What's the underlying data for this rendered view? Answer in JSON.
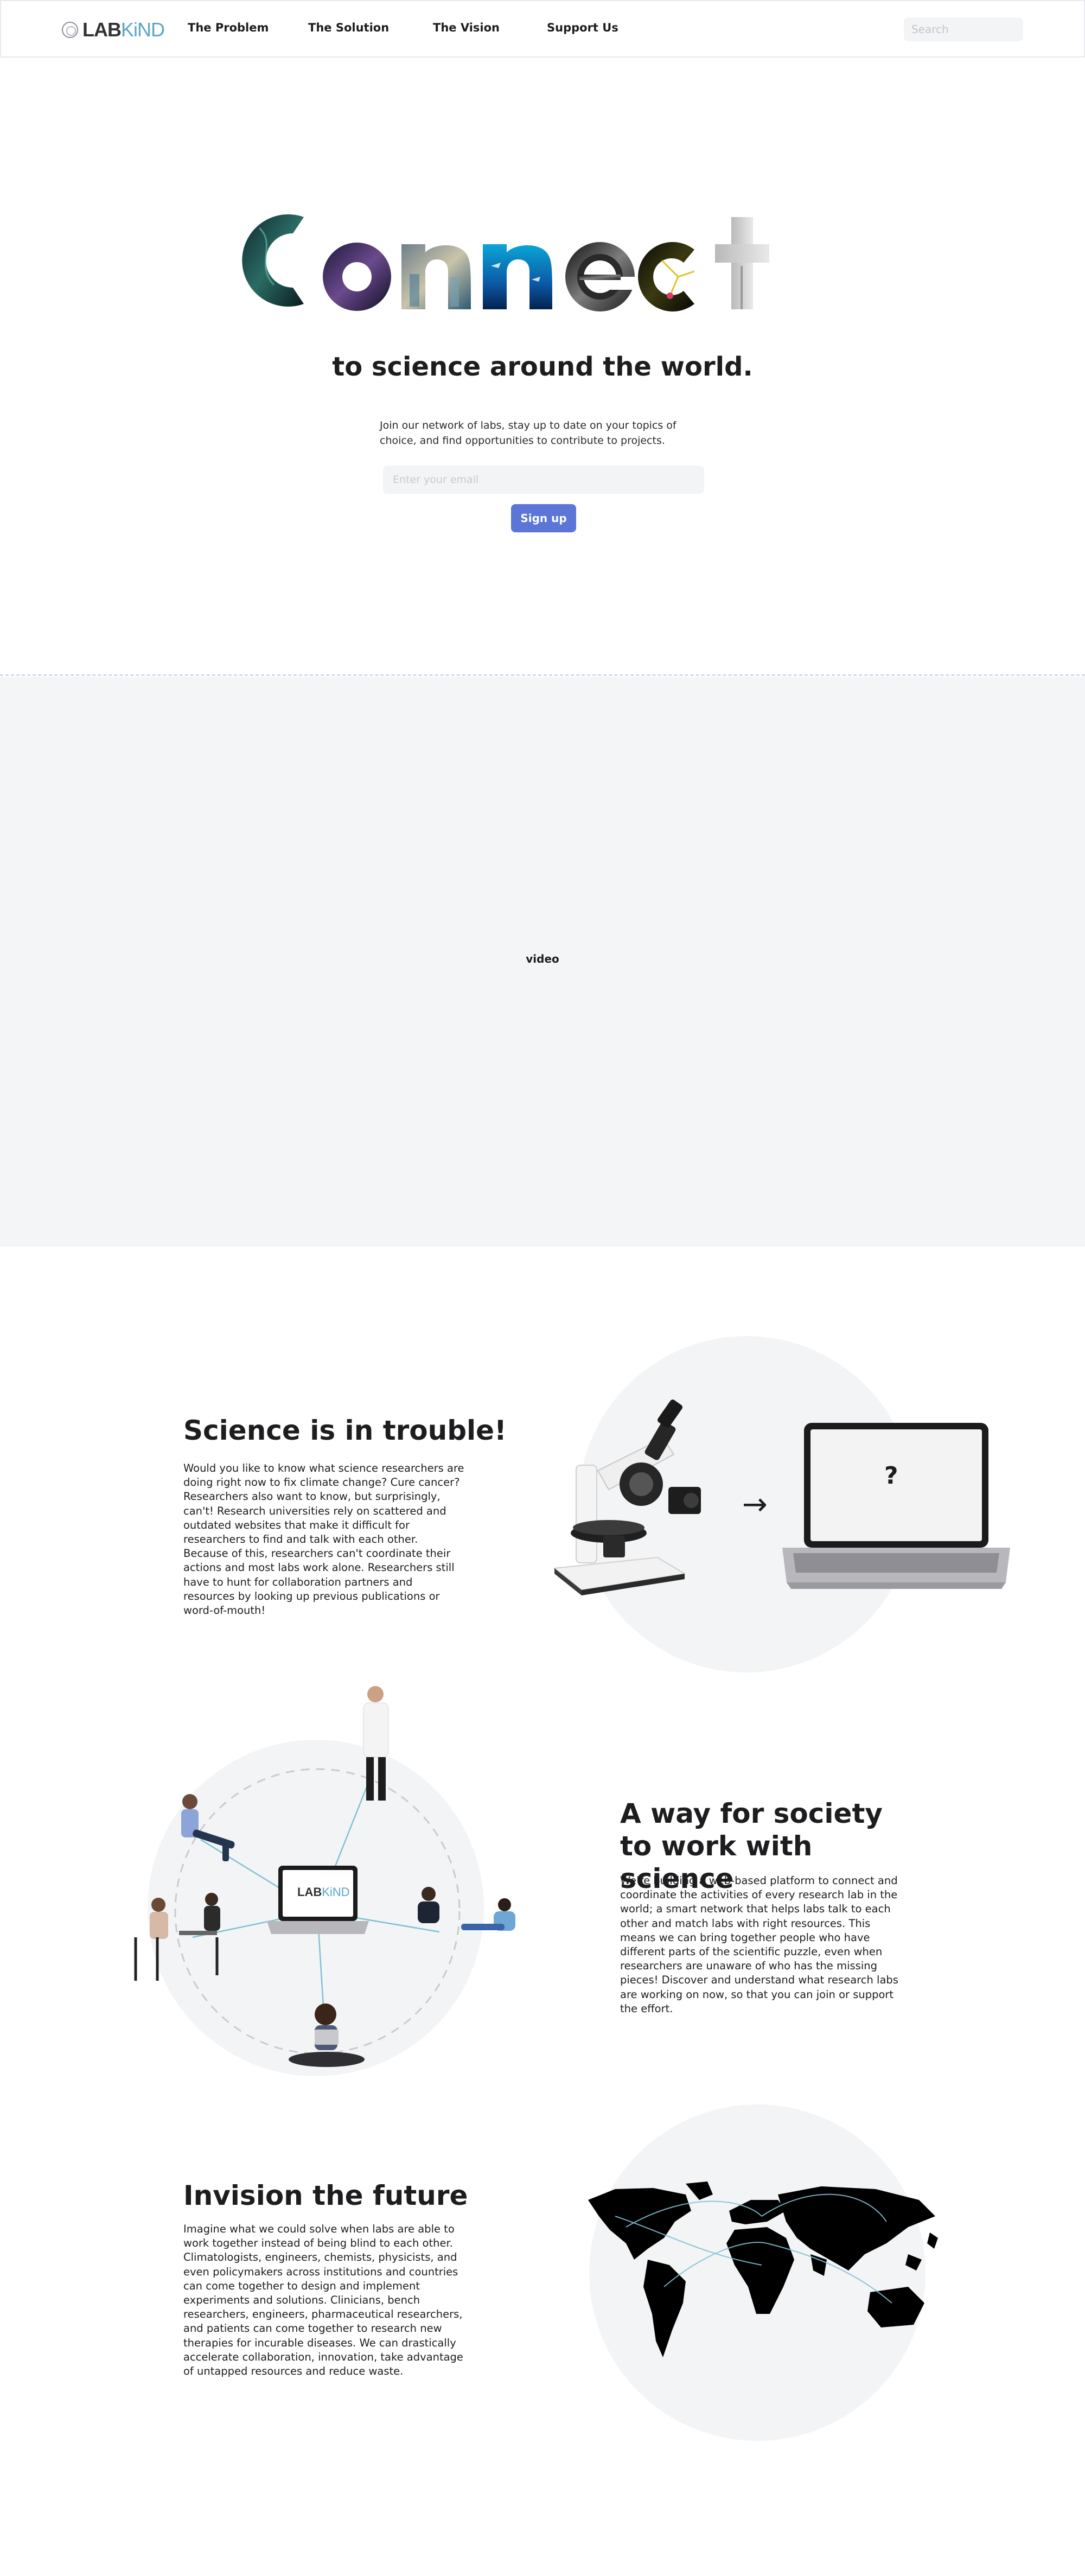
{
  "nav": {
    "logo_lab": "LAB",
    "logo_kind": "KiND",
    "links": [
      "The Problem",
      "The Solution",
      "The Vision",
      "Support Us"
    ],
    "search_placeholder": "Search"
  },
  "hero": {
    "title": "Connect",
    "subtitle": "to science around the world.",
    "description": "Join our network of labs, stay up to date on your topics of choice, and find opportunities to contribute to projects.",
    "email_placeholder": "Enter your email",
    "signup_label": "Sign up"
  },
  "video": {
    "label": "video"
  },
  "problem": {
    "heading": "Science is in trouble!",
    "body": "Would you like to know what science researchers are doing right now to fix climate change? Cure cancer? Researchers also want to know, but surprisingly, can't! Research universities rely on scattered and outdated websites that make it difficult for researchers to find and talk with each other. Because of this, researchers can't coordinate their actions and most labs work alone. Researchers still have to hunt for collaboration partners and resources by looking up previous publications or word-of-mouth!",
    "laptop_symbol": "?",
    "arrow_symbol": "→"
  },
  "solution": {
    "heading": "A way for society to work with science",
    "body": "We're building a web-based platform to connect and coordinate the activities of every research lab in the world; a smart network that helps labs talk to each other and match labs with right resources. This means we can bring together people who have different parts of the scientific puzzle, even when researchers are unaware of who has the missing pieces! Discover and understand what research labs are working on now, so that you can join or support the effort.",
    "laptop_logo_lab": "LAB",
    "laptop_logo_kind": "KiND"
  },
  "vision": {
    "heading": "Invision the future",
    "body": "Imagine what we could solve when labs are able to work together instead of being blind to each other. Climatologists, engineers, chemists, physicists, and even policymakers across institutions and countries can come together to design and implement experiments and solutions. Clinicians, bench researchers, engineers, pharmaceutical researchers, and patients can come together to research new therapies for incurable diseases. We can drastically accelerate collaboration, innovation, take advantage of untapped resources and reduce waste."
  },
  "colors": {
    "accent": "#5b76d6",
    "logo_kind": "#5aa6c8",
    "section_bg": "#f3f4f6",
    "divider": "#cbc4ee"
  }
}
